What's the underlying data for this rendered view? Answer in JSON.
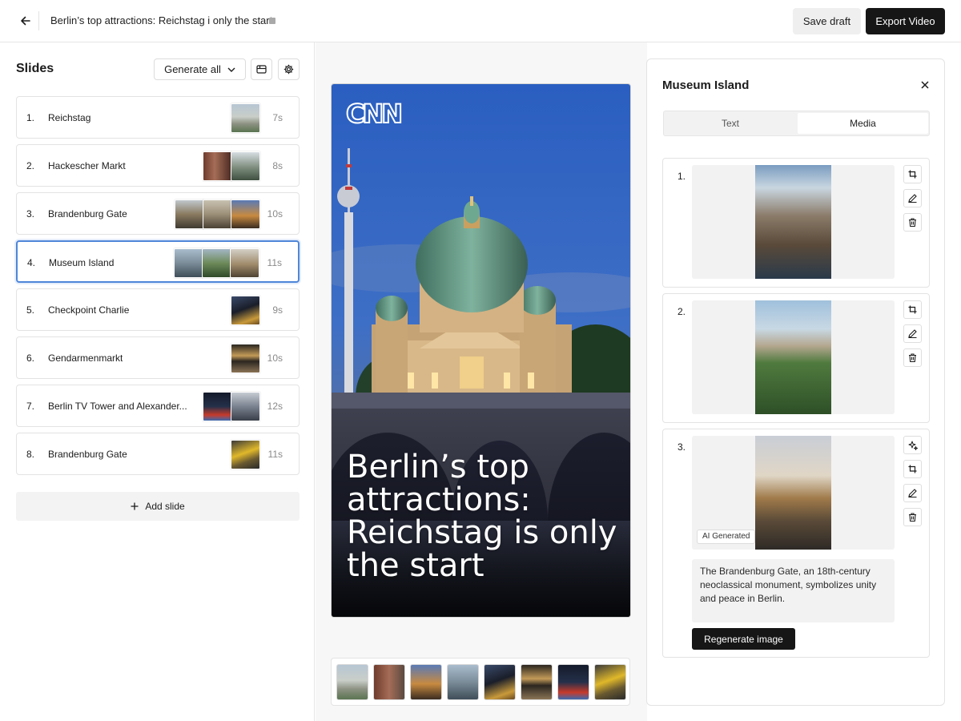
{
  "header": {
    "title": "Berlin’s top attractions: Reichstag i only the start",
    "save_label": "Save draft",
    "export_label": "Export Video"
  },
  "sidebar": {
    "heading": "Slides",
    "generate_all_label": "Generate all",
    "add_slide_label": "Add slide",
    "slides": [
      {
        "num": "1.",
        "name": "Reichstag",
        "duration": "7s"
      },
      {
        "num": "2.",
        "name": "Hackescher Markt",
        "duration": "8s"
      },
      {
        "num": "3.",
        "name": "Brandenburg Gate",
        "duration": "10s"
      },
      {
        "num": "4.",
        "name": "Museum Island",
        "duration": "11s"
      },
      {
        "num": "5.",
        "name": "Checkpoint Charlie",
        "duration": "9s"
      },
      {
        "num": "6.",
        "name": "Gendarmenmarkt",
        "duration": "10s"
      },
      {
        "num": "7.",
        "name": "Berlin TV Tower and Alexander...",
        "duration": "12s"
      },
      {
        "num": "8.",
        "name": "Brandenburg Gate",
        "duration": "11s"
      }
    ],
    "active_index": 3
  },
  "preview": {
    "logo_text": "CNN",
    "title": "Berlin’s top attractions: Reichstag is only the start"
  },
  "detail_panel": {
    "title": "Museum Island",
    "tabs": [
      {
        "label": "Text"
      },
      {
        "label": "Media"
      }
    ],
    "active_tab": "Media",
    "media": [
      {
        "num": "1."
      },
      {
        "num": "2."
      },
      {
        "num": "3.",
        "badge": "AI Generated",
        "caption": "The Brandenburg Gate, an 18th-century neoclassical monument, symbolizes unity and peace in Berlin.",
        "regenerate_label": "Regenerate image"
      }
    ]
  },
  "colors": {
    "accent_border": "#4f86d9",
    "primary_button": "#161616",
    "secondary_button": "#efefef"
  }
}
